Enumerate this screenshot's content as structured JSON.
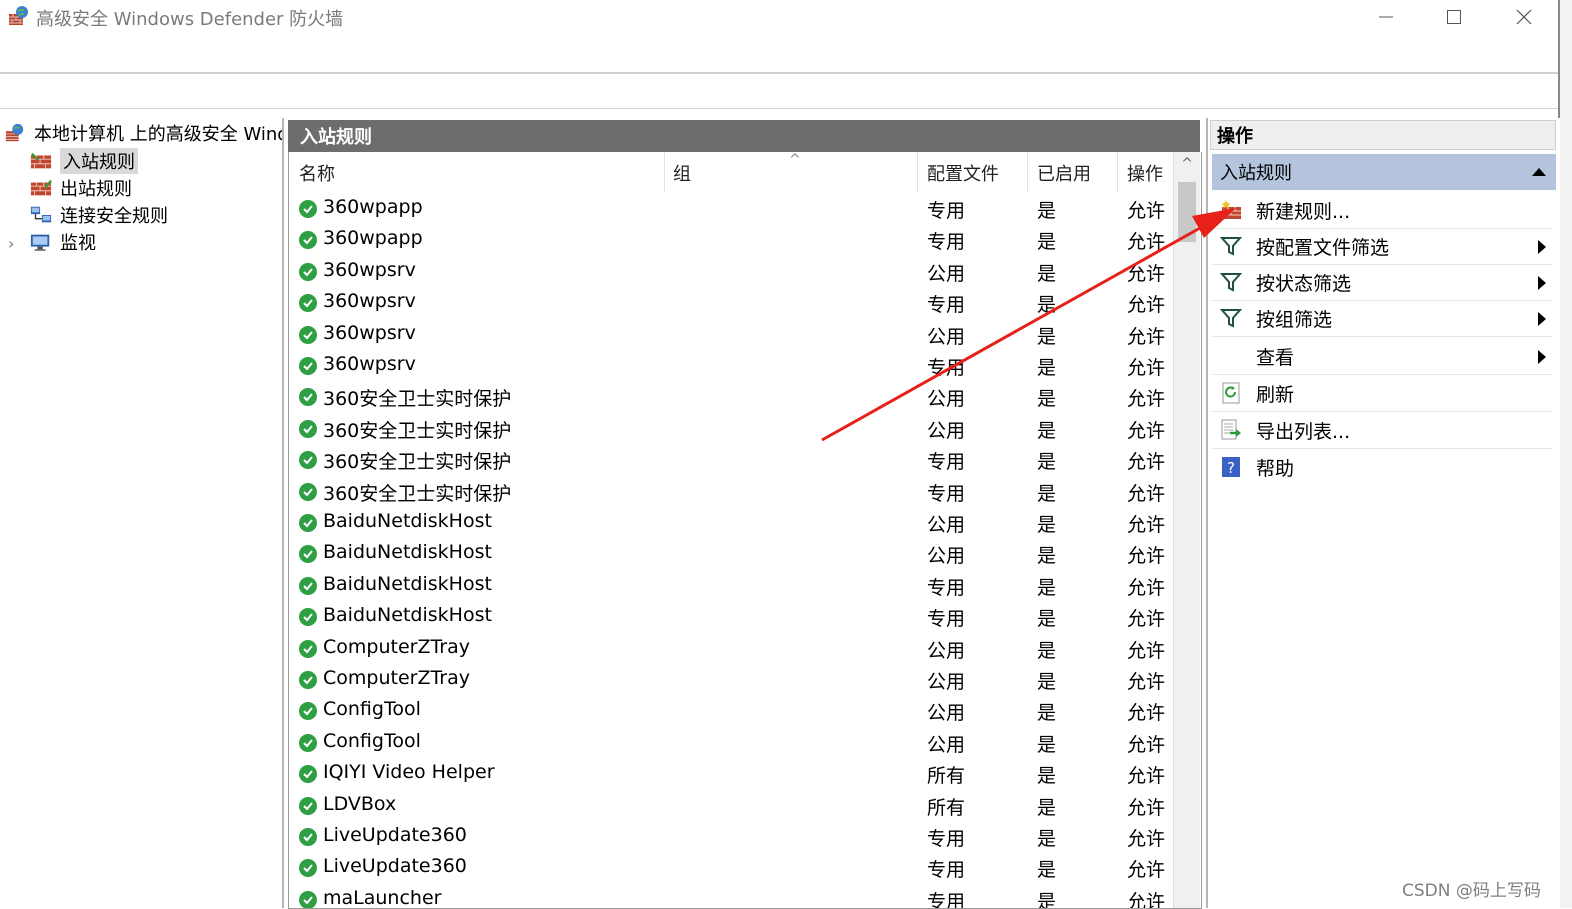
{
  "window": {
    "title": "高级安全 Windows Defender 防火墙"
  },
  "tree": {
    "root_label": "本地计算机 上的高级安全 Windows Defender 防火墙",
    "items": [
      {
        "label": "入站规则",
        "selected": true
      },
      {
        "label": "出站规则",
        "selected": false
      },
      {
        "label": "连接安全规则",
        "selected": false
      },
      {
        "label": "监视",
        "selected": false
      }
    ]
  },
  "center": {
    "title": "入站规则",
    "columns": [
      "名称",
      "组",
      "配置文件",
      "已启用",
      "操作"
    ],
    "rows": [
      {
        "name": "360wpapp",
        "group": "",
        "profile": "专用",
        "enabled": "是",
        "action": "允许"
      },
      {
        "name": "360wpapp",
        "group": "",
        "profile": "专用",
        "enabled": "是",
        "action": "允许"
      },
      {
        "name": "360wpsrv",
        "group": "",
        "profile": "公用",
        "enabled": "是",
        "action": "允许"
      },
      {
        "name": "360wpsrv",
        "group": "",
        "profile": "专用",
        "enabled": "是",
        "action": "允许"
      },
      {
        "name": "360wpsrv",
        "group": "",
        "profile": "公用",
        "enabled": "是",
        "action": "允许"
      },
      {
        "name": "360wpsrv",
        "group": "",
        "profile": "专用",
        "enabled": "是",
        "action": "允许"
      },
      {
        "name": "360安全卫士实时保护",
        "group": "",
        "profile": "公用",
        "enabled": "是",
        "action": "允许"
      },
      {
        "name": "360安全卫士实时保护",
        "group": "",
        "profile": "公用",
        "enabled": "是",
        "action": "允许"
      },
      {
        "name": "360安全卫士实时保护",
        "group": "",
        "profile": "专用",
        "enabled": "是",
        "action": "允许"
      },
      {
        "name": "360安全卫士实时保护",
        "group": "",
        "profile": "专用",
        "enabled": "是",
        "action": "允许"
      },
      {
        "name": "BaiduNetdiskHost",
        "group": "",
        "profile": "公用",
        "enabled": "是",
        "action": "允许"
      },
      {
        "name": "BaiduNetdiskHost",
        "group": "",
        "profile": "公用",
        "enabled": "是",
        "action": "允许"
      },
      {
        "name": "BaiduNetdiskHost",
        "group": "",
        "profile": "专用",
        "enabled": "是",
        "action": "允许"
      },
      {
        "name": "BaiduNetdiskHost",
        "group": "",
        "profile": "专用",
        "enabled": "是",
        "action": "允许"
      },
      {
        "name": "ComputerZTray",
        "group": "",
        "profile": "公用",
        "enabled": "是",
        "action": "允许"
      },
      {
        "name": "ComputerZTray",
        "group": "",
        "profile": "公用",
        "enabled": "是",
        "action": "允许"
      },
      {
        "name": "ConfigTool",
        "group": "",
        "profile": "公用",
        "enabled": "是",
        "action": "允许"
      },
      {
        "name": "ConfigTool",
        "group": "",
        "profile": "公用",
        "enabled": "是",
        "action": "允许"
      },
      {
        "name": "IQIYI Video Helper",
        "group": "",
        "profile": "所有",
        "enabled": "是",
        "action": "允许"
      },
      {
        "name": "LDVBox",
        "group": "",
        "profile": "所有",
        "enabled": "是",
        "action": "允许"
      },
      {
        "name": "LiveUpdate360",
        "group": "",
        "profile": "专用",
        "enabled": "是",
        "action": "允许"
      },
      {
        "name": "LiveUpdate360",
        "group": "",
        "profile": "专用",
        "enabled": "是",
        "action": "允许"
      },
      {
        "name": "maLauncher",
        "group": "",
        "profile": "专用",
        "enabled": "是",
        "action": "允许"
      }
    ]
  },
  "actions": {
    "title": "操作",
    "section": "入站规则",
    "items": [
      {
        "label": "新建规则...",
        "icon": "new-rule-icon",
        "submenu": false
      },
      {
        "label": "按配置文件筛选",
        "icon": "filter-icon",
        "submenu": true
      },
      {
        "label": "按状态筛选",
        "icon": "filter-icon",
        "submenu": true
      },
      {
        "label": "按组筛选",
        "icon": "filter-icon",
        "submenu": true
      },
      {
        "label": "查看",
        "icon": "",
        "submenu": true
      },
      {
        "label": "刷新",
        "icon": "refresh-icon",
        "submenu": false
      },
      {
        "label": "导出列表...",
        "icon": "export-icon",
        "submenu": false
      },
      {
        "label": "帮助",
        "icon": "help-icon",
        "submenu": false
      }
    ]
  },
  "watermark": "CSDN @码上写码",
  "colors": {
    "panel_header": "#6d6d6d",
    "actions_section": "#b4c4dc",
    "enabled_check": "#2ea043",
    "annotation_arrow": "#e8201a"
  }
}
